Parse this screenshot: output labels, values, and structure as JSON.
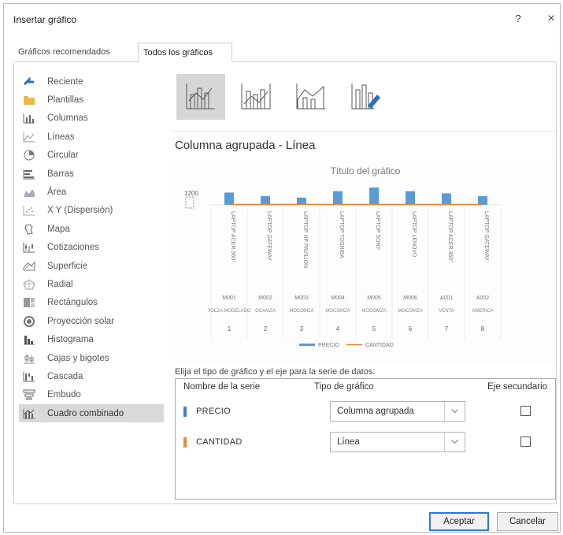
{
  "dialog": {
    "title": "Insertar gráfico",
    "help": "?",
    "close": "×"
  },
  "tabs": [
    "Gráficos recomendados",
    "Todos los gráficos"
  ],
  "sidebar": {
    "items": [
      {
        "label": "Reciente",
        "icon": "recent-icon"
      },
      {
        "label": "Plantillas",
        "icon": "folder-icon"
      },
      {
        "label": "Columnas",
        "icon": "column-chart-icon"
      },
      {
        "label": "Líneas",
        "icon": "line-chart-icon"
      },
      {
        "label": "Circular",
        "icon": "pie-chart-icon"
      },
      {
        "label": "Barras",
        "icon": "bar-chart-icon"
      },
      {
        "label": "Área",
        "icon": "area-chart-icon"
      },
      {
        "label": "X Y (Dispersión)",
        "icon": "scatter-chart-icon"
      },
      {
        "label": "Mapa",
        "icon": "map-chart-icon"
      },
      {
        "label": "Cotizaciones",
        "icon": "stock-chart-icon"
      },
      {
        "label": "Superficie",
        "icon": "surface-chart-icon"
      },
      {
        "label": "Radial",
        "icon": "radar-chart-icon"
      },
      {
        "label": "Rectángulos",
        "icon": "treemap-chart-icon"
      },
      {
        "label": "Proyección solar",
        "icon": "sunburst-chart-icon"
      },
      {
        "label": "Histograma",
        "icon": "histogram-chart-icon"
      },
      {
        "label": "Cajas y bigotes",
        "icon": "boxwhisker-chart-icon"
      },
      {
        "label": "Cascada",
        "icon": "waterfall-chart-icon"
      },
      {
        "label": "Embudo",
        "icon": "funnel-chart-icon"
      },
      {
        "label": "Cuadro combinado",
        "icon": "combo-chart-icon"
      }
    ],
    "selected_index": 18
  },
  "subtypes": [
    {
      "icon": "clustered-column-line-icon"
    },
    {
      "icon": "clustered-column-line-secondary-icon"
    },
    {
      "icon": "stacked-area-column-icon"
    },
    {
      "icon": "custom-combination-icon"
    }
  ],
  "combo_title": "Columna agrupada - Línea",
  "chart_data": {
    "type": "bar",
    "title": "Título del gráfico",
    "y_tick_top": "1200",
    "categories": [
      "1",
      "2",
      "3",
      "4",
      "5",
      "6",
      "7",
      "8"
    ],
    "category_codes": [
      "M001",
      "M002",
      "M003",
      "M004",
      "M005",
      "M006",
      "A001",
      "A002"
    ],
    "category_names": [
      "LAPTOP ACER 360°",
      "LAPTOP GATEWAY",
      "LAPTOP HP PAVILION",
      "LAPTOP TOSHIBA",
      "LAPTOP SONY",
      "LAPTOP LENOVO",
      "LAPTOP ACER 360°",
      "LAPTOP GATEWAY"
    ],
    "category_groups": [
      "TOLZA MODELADO",
      "OCAMZA",
      "MOCOMZA",
      "MOCOMZA",
      "MOCOMZA",
      "MOCOMZA",
      "VENTA",
      "AMERICA"
    ],
    "series": [
      {
        "name": "PRECIO",
        "type": "column",
        "values": [
          850,
          600,
          500,
          950,
          1200,
          950,
          800,
          600
        ],
        "color": "#5b9bd5"
      },
      {
        "name": "CANTIDAD",
        "type": "line",
        "values": [
          3,
          2,
          4,
          2,
          3,
          2,
          3,
          2
        ],
        "color": "#ed7d31"
      }
    ],
    "ylim": [
      0,
      1200
    ],
    "legend": "bottom"
  },
  "series_section": {
    "label": "Elija el tipo de gráfico y el eje para la serie de datos:",
    "headers": {
      "name": "Nombre de la serie",
      "type": "Tipo de gráfico",
      "secondary": "Eje secundario"
    },
    "rows": [
      {
        "name": "PRECIO",
        "type": "Columna agrupada",
        "color": "#3d7fd1",
        "secondary": false
      },
      {
        "name": "CANTIDAD",
        "type": "Línea",
        "color": "#e98a3b",
        "secondary": false
      }
    ]
  },
  "buttons": {
    "ok": "Aceptar",
    "cancel": "Cancelar"
  }
}
